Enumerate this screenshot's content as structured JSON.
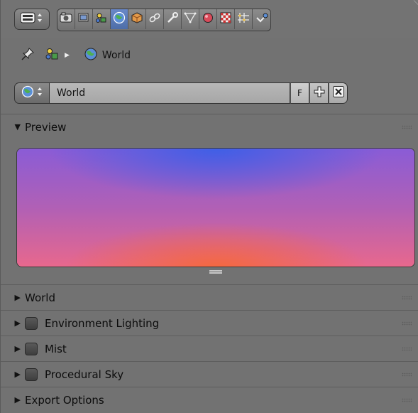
{
  "header": {
    "editor_type_icon": "properties-editor-icon",
    "tabs": [
      {
        "icon": "render-icon",
        "active": false
      },
      {
        "icon": "render-layers-icon",
        "active": false
      },
      {
        "icon": "scene-icon",
        "active": false
      },
      {
        "icon": "world-icon",
        "active": true
      },
      {
        "icon": "object-icon",
        "active": false
      },
      {
        "icon": "constraints-icon",
        "active": false
      },
      {
        "icon": "modifiers-icon",
        "active": false
      },
      {
        "icon": "object-data-icon",
        "active": false
      },
      {
        "icon": "material-icon",
        "active": false
      },
      {
        "icon": "texture-icon",
        "active": false
      },
      {
        "icon": "particles-icon",
        "active": false
      },
      {
        "icon": "physics-icon",
        "active": false
      }
    ]
  },
  "breadcrumb": {
    "items": [
      "World"
    ],
    "icons": [
      "pin-icon",
      "scene-icon",
      "world-icon"
    ]
  },
  "datablock": {
    "name": "World",
    "fake_user_label": "F",
    "add_icon": "plus-icon",
    "unlink_icon": "x-icon"
  },
  "panels": [
    {
      "label": "Preview",
      "expanded": true,
      "has_checkbox": false
    },
    {
      "label": "World",
      "expanded": false,
      "has_checkbox": false
    },
    {
      "label": "Environment Lighting",
      "expanded": false,
      "has_checkbox": true
    },
    {
      "label": "Mist",
      "expanded": false,
      "has_checkbox": true
    },
    {
      "label": "Procedural Sky",
      "expanded": false,
      "has_checkbox": true
    },
    {
      "label": "Export Options",
      "expanded": false,
      "has_checkbox": false
    }
  ],
  "preview": {
    "zenith_color": "#3f5fe6",
    "mid_color": "#9a5ec7",
    "horizon_color": "#f4683f"
  },
  "colors": {
    "background": "#727272",
    "active_tab": "#5b7cc0",
    "field": "#aeaeae"
  }
}
